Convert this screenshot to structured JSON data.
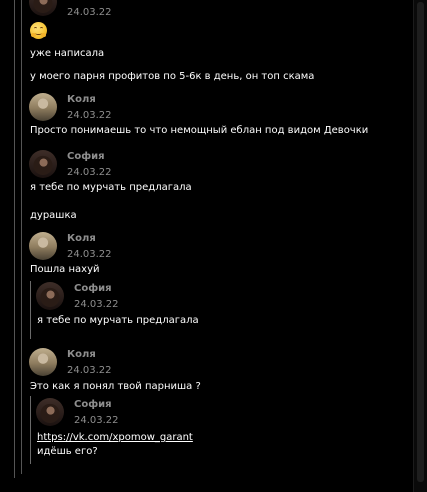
{
  "messages": [
    {
      "date": "24.03.22"
    },
    {
      "text": "уже написала"
    },
    {
      "text": "у моего парня профитов по 5-6к в день, он топ скама"
    },
    {
      "name": "Коля",
      "date": "24.03.22",
      "text": "Просто понимаешь то что немощный еблан под видом Девочки"
    },
    {
      "name": "София",
      "date": "24.03.22",
      "text": "я тебе по мурчать предлагала",
      "text2": "дурашка"
    },
    {
      "name": "Коля",
      "date": "24.03.22",
      "text": "Пошла нахуй"
    },
    {
      "name": "София",
      "date": "24.03.22",
      "text": "я тебе по мурчать предлагала"
    },
    {
      "name": "Коля",
      "date": "24.03.22",
      "text": "Это как я понял твой парниша ?"
    },
    {
      "name": "София",
      "date": "24.03.22",
      "link": "https://vk.com/xpomow_garant",
      "text": "идёшь его?"
    }
  ],
  "icons": {
    "emoji": "hugging-face-emoji",
    "avatar_kolya": "avatar-kolya",
    "avatar_sofia": "avatar-sofia"
  },
  "colors": {
    "background": "#000000",
    "text": "#ffffff",
    "meta": "#8e8e8e",
    "quote_line": "#6a6a6a"
  }
}
